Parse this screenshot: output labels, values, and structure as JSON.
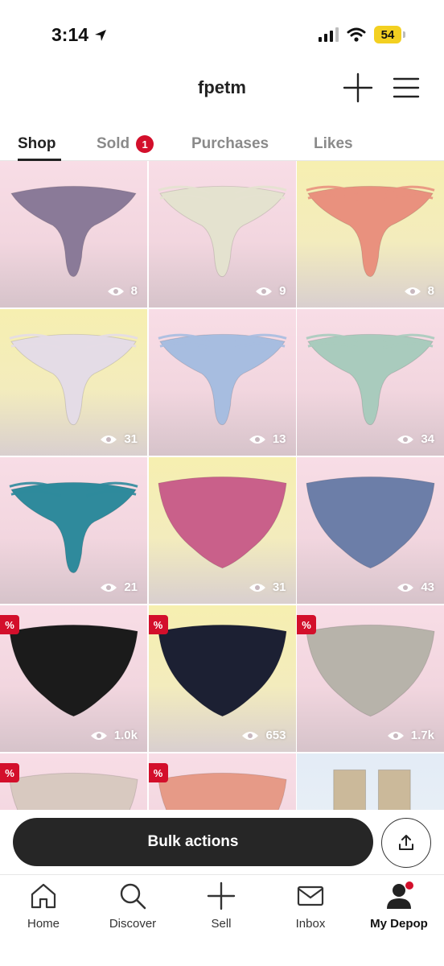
{
  "status_bar": {
    "time": "3:14",
    "battery": "54"
  },
  "header": {
    "username": "fpetm"
  },
  "tabs": [
    {
      "label": "Shop",
      "active": true
    },
    {
      "label": "Sold",
      "badge": "1"
    },
    {
      "label": "Purchases"
    },
    {
      "label": "Likes"
    }
  ],
  "listings": [
    {
      "views": "8",
      "bg": "pink",
      "color": "#8a7a98"
    },
    {
      "views": "9",
      "bg": "pink",
      "color": "#e4e2cf"
    },
    {
      "views": "8",
      "bg": "yellow",
      "color": "#e9917e"
    },
    {
      "views": "31",
      "bg": "yellow",
      "color": "#e4dce6"
    },
    {
      "views": "13",
      "bg": "pink",
      "color": "#a7bde0"
    },
    {
      "views": "34",
      "bg": "pink",
      "color": "#a9cbbd"
    },
    {
      "views": "21",
      "bg": "pink",
      "color": "#2f8a9c"
    },
    {
      "views": "31",
      "bg": "yellow",
      "color": "#c9608a"
    },
    {
      "views": "43",
      "bg": "pink",
      "color": "#6c7ea8"
    },
    {
      "views": "1.0k",
      "bg": "pink",
      "color": "#1b1b1b",
      "sale": "%"
    },
    {
      "views": "653",
      "bg": "yellow",
      "color": "#1c2033",
      "sale": "%"
    },
    {
      "views": "1.7k",
      "bg": "pink",
      "color": "#b7b3aa",
      "sale": "%"
    },
    {
      "views": "",
      "bg": "pink",
      "color": "#d8c9c0",
      "sale": "%"
    },
    {
      "views": "",
      "bg": "pink",
      "color": "#e69a87",
      "sale": "%"
    },
    {
      "views": "",
      "bg": "blue",
      "color": "#cbb99a"
    }
  ],
  "actions": {
    "bulk_label": "Bulk actions"
  },
  "nav": [
    {
      "label": "Home"
    },
    {
      "label": "Discover"
    },
    {
      "label": "Sell"
    },
    {
      "label": "Inbox"
    },
    {
      "label": "My Depop",
      "active": true
    }
  ],
  "colors": {
    "accent": "#d30f2b",
    "dark": "#262626"
  }
}
